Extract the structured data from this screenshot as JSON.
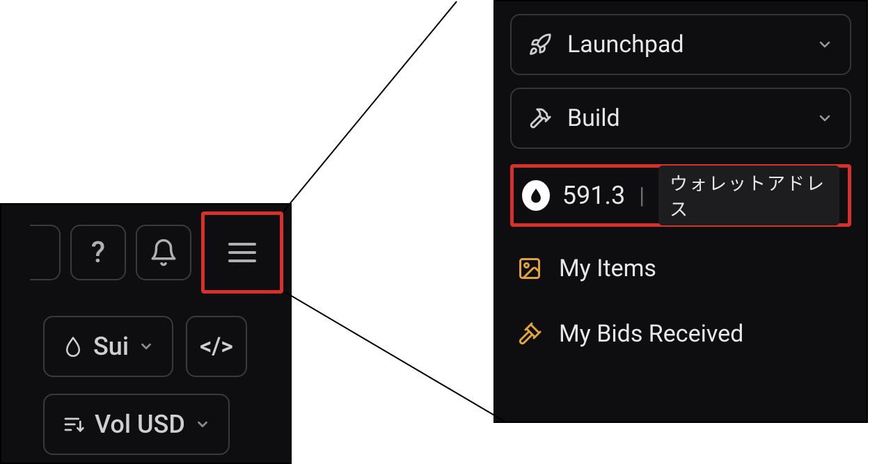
{
  "toolbar": {
    "help_label": "?",
    "chain_selector": {
      "label": "Sui"
    },
    "sort_selector": {
      "label": "Vol USD"
    },
    "code_btn_label": "</>"
  },
  "menu": {
    "items": [
      {
        "label": "Launchpad"
      },
      {
        "label": "Build"
      }
    ],
    "wallet": {
      "balance": "591.3",
      "address_label": "ウォレットアドレス"
    },
    "links": [
      {
        "label": "My Items"
      },
      {
        "label": "My Bids Received"
      }
    ]
  },
  "colors": {
    "highlight": "#d8302a",
    "accent": "#e0a43a",
    "bg": "#0e0e10"
  }
}
